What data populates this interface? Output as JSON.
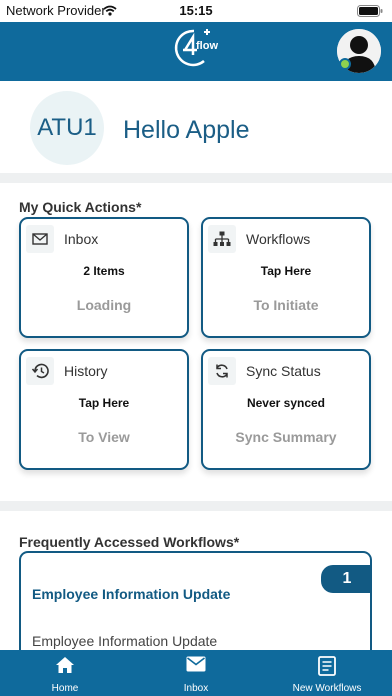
{
  "status_bar": {
    "provider": "Network Provider",
    "time": "15:15"
  },
  "header": {
    "logo_text": "flow",
    "logo_icon": "4flow-logo",
    "avatar_icon": "user-avatar-icon",
    "online_status_color": "#8fd14f"
  },
  "profile": {
    "initials": "ATU1",
    "greeting": "Hello Apple"
  },
  "quick_actions": {
    "title": "My Quick Actions*",
    "cards": [
      {
        "icon": "mail-icon",
        "title": "Inbox",
        "line1": "2 Items",
        "line2": "Loading"
      },
      {
        "icon": "hierarchy-icon",
        "title": "Workflows",
        "line1": "Tap Here",
        "line2": "To Initiate"
      },
      {
        "icon": "history-icon",
        "title": "History",
        "line1": "Tap Here",
        "line2": "To View"
      },
      {
        "icon": "sync-icon",
        "title": "Sync Status",
        "line1": "Never synced",
        "line2": "Sync Summary"
      }
    ]
  },
  "frequent_workflows": {
    "title": "Frequently Accessed Workflows*",
    "items": [
      {
        "title": "Employee Information Update",
        "count": "1",
        "subtitle": "Employee Information Update"
      }
    ]
  },
  "bottom_nav": {
    "items": [
      {
        "icon": "home-icon",
        "label": "Home"
      },
      {
        "icon": "inbox-icon",
        "label": "Inbox"
      },
      {
        "icon": "new-workflows-icon",
        "label": "New Workflows"
      }
    ]
  },
  "colors": {
    "brand": "#0f6a9c",
    "accent": "#125a83",
    "muted_text": "#9a9a9a"
  }
}
